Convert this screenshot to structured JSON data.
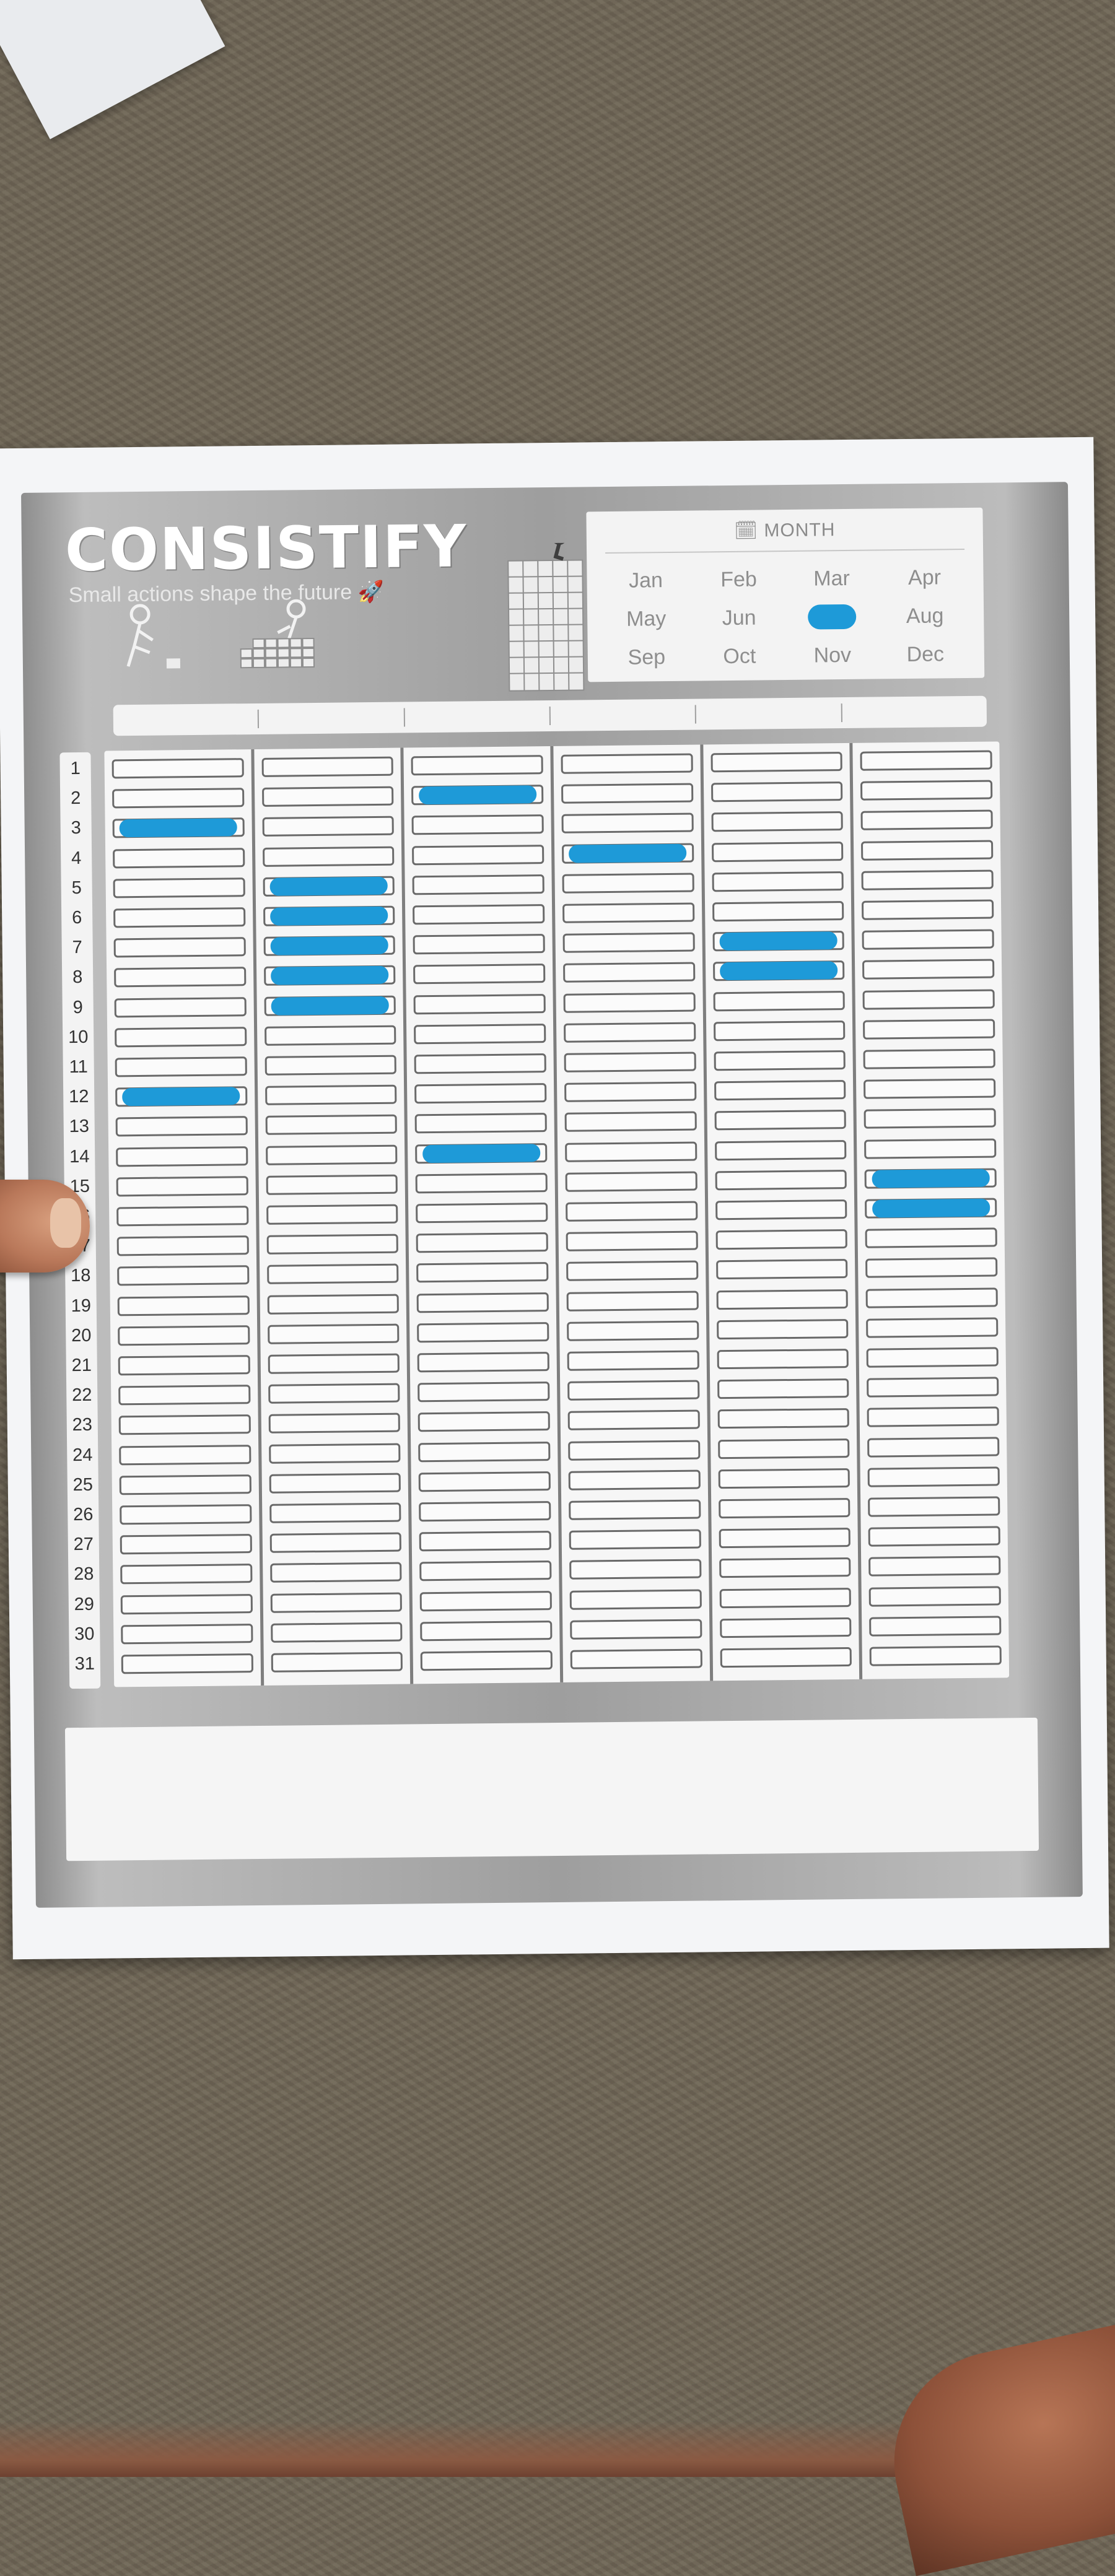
{
  "sheet": {
    "brand": "CONSISTIFY",
    "tagline": "Small actions shape the future 🚀",
    "month_title": "MONTH",
    "months": [
      "Jan",
      "Feb",
      "Mar",
      "Apr",
      "May",
      "Jun",
      "Jul",
      "Aug",
      "Sep",
      "Oct",
      "Nov",
      "Dec"
    ],
    "marked_month": "Jul",
    "days": [
      "1",
      "2",
      "3",
      "4",
      "5",
      "6",
      "7",
      "8",
      "9",
      "10",
      "11",
      "12",
      "13",
      "14",
      "15",
      "16",
      "17",
      "18",
      "19",
      "20",
      "21",
      "22",
      "23",
      "24",
      "25",
      "26",
      "27",
      "28",
      "29",
      "30",
      "31"
    ],
    "habit_columns": 6,
    "checked_days_by_column": [
      [
        3,
        12
      ],
      [
        5,
        6,
        7,
        8,
        9
      ],
      [
        2,
        14
      ],
      [
        4
      ],
      [
        7,
        8
      ],
      [
        15,
        16
      ]
    ],
    "ink_color": "#1e9ad8"
  }
}
